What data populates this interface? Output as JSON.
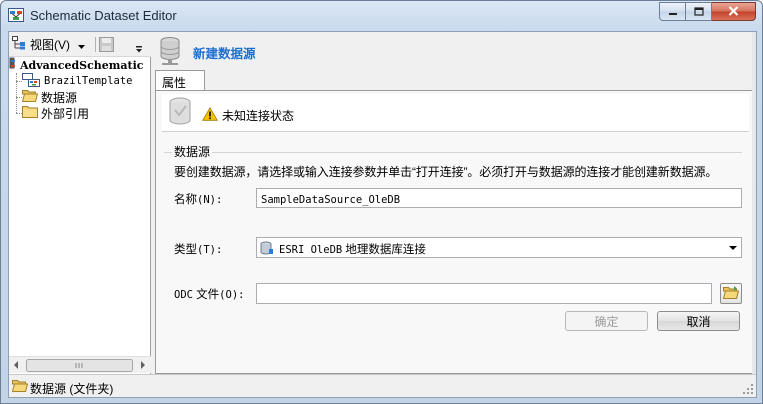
{
  "window": {
    "title": "Schematic Dataset Editor"
  },
  "tree_toolbar": {
    "view_label": "视图(V)"
  },
  "tree": {
    "root": "AdvancedSchematic",
    "items": [
      {
        "label": "BrazilTemplate",
        "icon": "template-icon"
      },
      {
        "label": "数据源",
        "icon": "open-folder-icon"
      },
      {
        "label": "外部引用",
        "icon": "folder-icon"
      }
    ]
  },
  "header": {
    "title": "新建数据源"
  },
  "tabs": {
    "properties": "属性"
  },
  "connection": {
    "status": "未知连接状态"
  },
  "datasource": {
    "group_label": "数据源",
    "description": "要创建数据源，请选择或输入连接参数并单击“打开连接”。必须打开与数据源的连接才能创建新数据源。",
    "name_label": "名称",
    "name_accel": "(N):",
    "name_value": "SampleDataSource_OleDB",
    "type_label": "类型",
    "type_accel": "(T):",
    "type_value_mono": "ESRI OleDB",
    "type_value_text": "地理数据库连接",
    "odc_label_mono": "ODC",
    "odc_label_text": "文件",
    "odc_accel": "(O):",
    "odc_value": ""
  },
  "buttons": {
    "ok": "确定",
    "cancel": "取消"
  },
  "statusbar": {
    "text": "数据源 (文件夹)"
  },
  "colors": {
    "header_title": "#1f6fd0",
    "close_button": "#c2412a",
    "warning": "#f5c400"
  }
}
